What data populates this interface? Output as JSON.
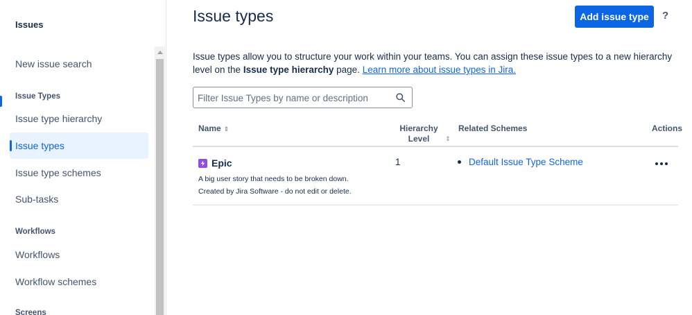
{
  "sidebar": {
    "title": "Issues",
    "items": [
      {
        "label": "New issue search",
        "active": false
      },
      {
        "label": "Issue type hierarchy",
        "active": false
      },
      {
        "label": "Issue types",
        "active": true
      },
      {
        "label": "Issue type schemes",
        "active": false
      },
      {
        "label": "Sub-tasks",
        "active": false
      },
      {
        "label": "Workflows",
        "active": false
      },
      {
        "label": "Workflow schemes",
        "active": false
      }
    ],
    "sections": {
      "issue_types": "Issue Types",
      "workflows": "Workflows",
      "screens": "Screens"
    }
  },
  "header": {
    "title": "Issue types",
    "add_button": "Add issue type",
    "help": "?"
  },
  "description": {
    "text_before": "Issue types allow you to structure your work within your teams. You can assign these issue types to a new hierarchy level on the ",
    "bold": "Issue type hierarchy",
    "text_after": " page. ",
    "link": "Learn more about issue types in Jira."
  },
  "filter": {
    "placeholder": "Filter Issue Types by name or description",
    "value": ""
  },
  "table": {
    "columns": {
      "name": "Name",
      "hierarchy_line1": "Hierarchy",
      "hierarchy_line2": "Level",
      "schemes": "Related Schemes",
      "actions": "Actions"
    },
    "rows": [
      {
        "name": "Epic",
        "description_line1": "A big user story that needs to be broken down.",
        "description_line2": "Created by Jira Software - do not edit or delete.",
        "hierarchy_level": "1",
        "schemes": [
          "Default Issue Type Scheme"
        ],
        "icon": "epic-icon"
      }
    ]
  },
  "colors": {
    "accent": "#0c66e4",
    "epic": "#904ee2",
    "active_bg": "#e9f2ff"
  }
}
